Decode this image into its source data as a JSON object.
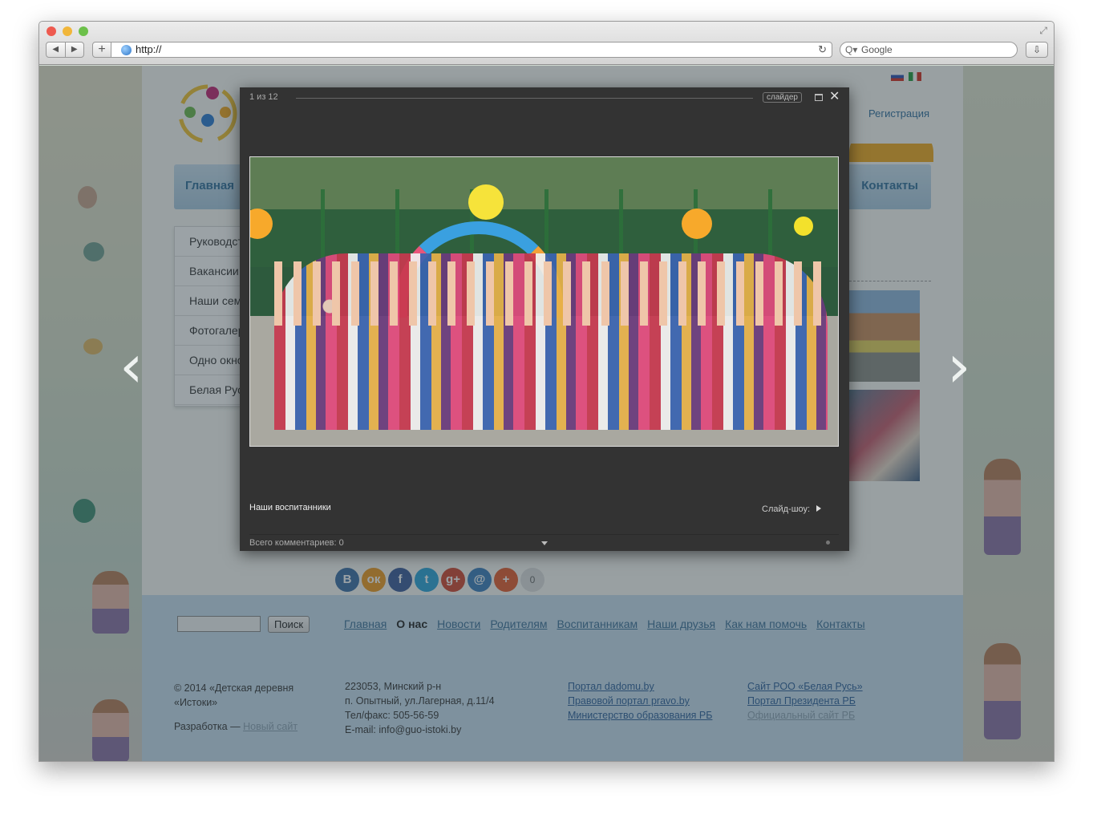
{
  "browser": {
    "url": "http://",
    "search_placeholder": "Google",
    "back_icon": "◀",
    "forward_icon": "▶",
    "new_tab_icon": "+",
    "reload_icon": "↻",
    "search_icon": "Q▾",
    "download_icon": "⇩",
    "fullscreen_icon": "⤢"
  },
  "header": {
    "register": "Регистрация",
    "lang_icons": [
      "russian-flag",
      "italian-flag"
    ]
  },
  "nav": {
    "home": "Главная",
    "contacts": "Контакты"
  },
  "sidebar": {
    "items": [
      "Руководство",
      "Вакансии",
      "Наши семьи",
      "Фотогалерея",
      "Одно окно",
      "Белая Русь"
    ]
  },
  "gallery_arrows": {
    "prev": "‹",
    "next": "›"
  },
  "lightbox": {
    "counter": "1 из 12",
    "slider_button": "слайдер",
    "close_icon": "✕",
    "caption": "Наши воспитанники",
    "slideshow_label": "Слайд-шоу:",
    "comments": "Всего комментариев: 0"
  },
  "share": {
    "buttons": [
      {
        "label": "В",
        "color": "#3b6ea5"
      },
      {
        "label": "ок",
        "color": "#f09a1e"
      },
      {
        "label": "f",
        "color": "#3b5b9a"
      },
      {
        "label": "t",
        "color": "#2aa3d9"
      },
      {
        "label": "g+",
        "color": "#d2452f"
      },
      {
        "label": "@",
        "color": "#3a7ebd"
      },
      {
        "label": "+",
        "color": "#e65a2b"
      }
    ],
    "count": "0"
  },
  "footer": {
    "search_button": "Поиск",
    "nav": [
      "Главная",
      "О нас",
      "Новости",
      "Родителям",
      "Воспитанникам",
      "Наши друзья",
      "Как нам помочь",
      "Контакты"
    ],
    "copyright_line1": "© 2014 «Детская деревня",
    "copyright_line2": "«Истоки»",
    "dev_label": "Разработка —",
    "dev_link": "Новый сайт",
    "address": [
      "223053, Минский р-н",
      "п. Опытный, ул.Лагерная, д.11/4",
      "Тел/факс: 505-56-59",
      "E-mail: info@guo-istoki.by"
    ],
    "links_col1": [
      "Портал dadomu.by",
      "Правовой портал pravo.by",
      "Министерство образования РБ"
    ],
    "links_col2": [
      "Сайт РОО «Белая Русь»",
      "Портал Президента РБ",
      "Официальный сайт РБ"
    ]
  }
}
